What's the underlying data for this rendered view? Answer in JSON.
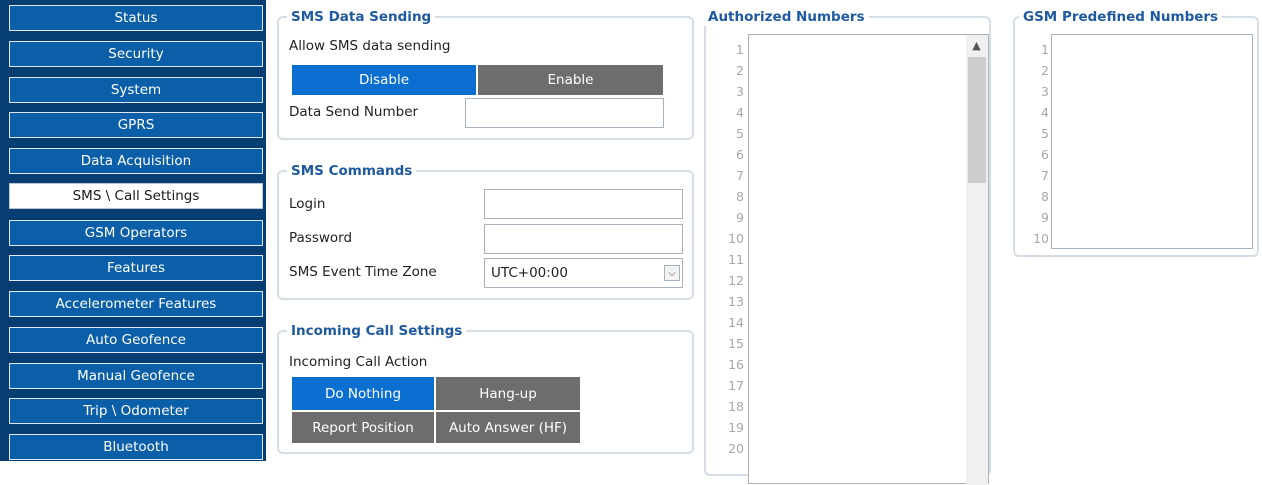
{
  "sidebar": {
    "items": [
      {
        "label": "Status",
        "active": false
      },
      {
        "label": "Security",
        "active": false
      },
      {
        "label": "System",
        "active": false
      },
      {
        "label": "GPRS",
        "active": false
      },
      {
        "label": "Data Acquisition",
        "active": false
      },
      {
        "label": "SMS \\ Call Settings",
        "active": true
      },
      {
        "label": "GSM Operators",
        "active": false
      },
      {
        "label": "Features",
        "active": false
      },
      {
        "label": "Accelerometer Features",
        "active": false
      },
      {
        "label": "Auto Geofence",
        "active": false
      },
      {
        "label": "Manual Geofence",
        "active": false
      },
      {
        "label": "Trip \\ Odometer",
        "active": false
      },
      {
        "label": "Bluetooth",
        "active": false
      }
    ]
  },
  "sms_data_sending": {
    "title": "SMS Data Sending",
    "allow_label": "Allow SMS data sending",
    "options": [
      {
        "label": "Disable",
        "selected": true
      },
      {
        "label": "Enable",
        "selected": false
      }
    ],
    "data_send_number_label": "Data Send Number",
    "data_send_number_value": ""
  },
  "sms_commands": {
    "title": "SMS Commands",
    "login_label": "Login",
    "login_value": "",
    "password_label": "Password",
    "password_value": "",
    "timezone_label": "SMS Event Time Zone",
    "timezone_value": "UTC+00:00"
  },
  "incoming_call": {
    "title": "Incoming Call Settings",
    "action_label": "Incoming Call Action",
    "options": [
      {
        "label": "Do Nothing",
        "selected": true
      },
      {
        "label": "Hang-up",
        "selected": false
      },
      {
        "label": "Report Position",
        "selected": false
      },
      {
        "label": "Auto Answer (HF)",
        "selected": false
      }
    ]
  },
  "authorized_numbers": {
    "title": "Authorized Numbers",
    "line_numbers": [
      "1",
      "2",
      "3",
      "4",
      "5",
      "6",
      "7",
      "8",
      "9",
      "10",
      "11",
      "12",
      "13",
      "14",
      "15",
      "16",
      "17",
      "18",
      "19",
      "20"
    ]
  },
  "gsm_predefined": {
    "title": "GSM Predefined Numbers",
    "line_numbers": [
      "1",
      "2",
      "3",
      "4",
      "5",
      "6",
      "7",
      "8",
      "9",
      "10"
    ]
  },
  "colors": {
    "sidebar_bg": "#063d73",
    "sidebar_item": "#0a5fa8",
    "selected_segment": "#0a6fd1",
    "unselected_segment": "#6d6d6d",
    "legend_text": "#1f5aa0"
  }
}
